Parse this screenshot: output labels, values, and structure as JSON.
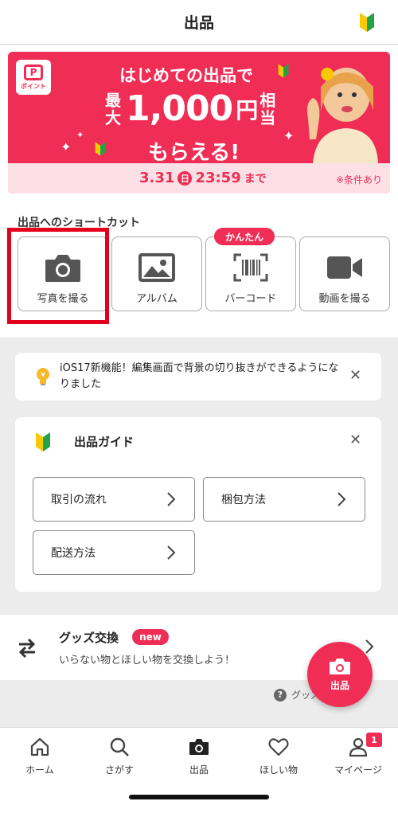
{
  "header": {
    "title": "出品"
  },
  "banner": {
    "logo_text": "ポイント",
    "line1": "はじめての出品で",
    "line2_left": "最大",
    "amount": "1,000",
    "yen": "円",
    "line2_right": "相当",
    "line3": "もらえる!",
    "date": "3.31",
    "day": "日",
    "time": "23:59",
    "until": "まで",
    "note": "※条件あり"
  },
  "shortcut": {
    "title": "出品へのショートカット",
    "badge": "かんたん",
    "items": [
      {
        "label": "写真を撮る",
        "icon": "camera-icon"
      },
      {
        "label": "アルバム",
        "icon": "image-icon"
      },
      {
        "label": "バーコード",
        "icon": "barcode-icon"
      },
      {
        "label": "動画を撮る",
        "icon": "video-icon"
      }
    ]
  },
  "notice": {
    "text": "iOS17新機能！編集画面で背景の切り抜きができるようになりました"
  },
  "guide": {
    "title": "出品ガイド",
    "items": [
      {
        "label": "取引の流れ"
      },
      {
        "label": "梱包方法"
      },
      {
        "label": "配送方法"
      }
    ]
  },
  "goods": {
    "title": "グッズ交換",
    "badge": "new",
    "subtitle": "いらない物とほしい物を交換しよう！",
    "help": "グッズ交換とは？"
  },
  "fab": {
    "label": "出品"
  },
  "nav": {
    "items": [
      {
        "label": "ホーム"
      },
      {
        "label": "さがす"
      },
      {
        "label": "出品"
      },
      {
        "label": "ほしい物"
      },
      {
        "label": "マイページ"
      }
    ],
    "badge_count": "1"
  },
  "colors": {
    "accent": "#ef2d55",
    "highlight": "#e3001b"
  }
}
